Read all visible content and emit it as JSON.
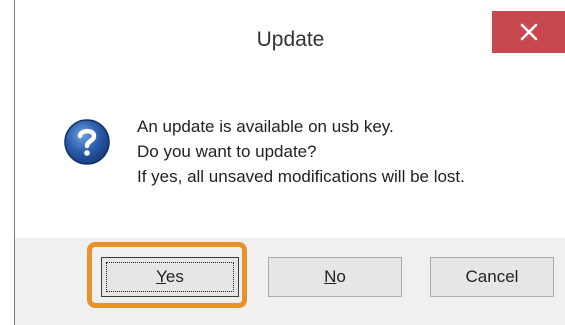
{
  "window": {
    "title": "Update",
    "close_icon": "close-icon"
  },
  "message": {
    "icon": "question-icon",
    "lines": [
      "An update is available on usb key.",
      "Do you want to update?",
      "If yes, all unsaved modifications will be lost."
    ]
  },
  "buttons": {
    "yes": {
      "mnemonic": "Y",
      "rest": "es"
    },
    "no": {
      "mnemonic": "N",
      "rest": "o"
    },
    "cancel": {
      "label": "Cancel"
    }
  },
  "colors": {
    "close_button": "#c7474f",
    "highlight": "#e8922a",
    "icon": "#2a5aa8"
  }
}
